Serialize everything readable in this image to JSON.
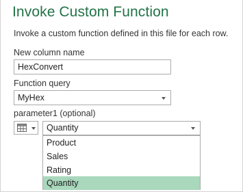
{
  "dialog": {
    "title": "Invoke Custom Function",
    "description": "Invoke a custom function defined in this file for each row."
  },
  "new_column": {
    "label": "New column name",
    "value": "HexConvert"
  },
  "function_query": {
    "label": "Function query",
    "value": "MyHex"
  },
  "parameter1": {
    "label": "parameter1 (optional)",
    "type_icon": "table-icon",
    "value": "Quantity",
    "options": [
      "Product",
      "Sales",
      "Rating",
      "Quantity"
    ],
    "selected_index": 3
  },
  "colors": {
    "title": "#217346",
    "selected_option": "#a9d8bd"
  }
}
